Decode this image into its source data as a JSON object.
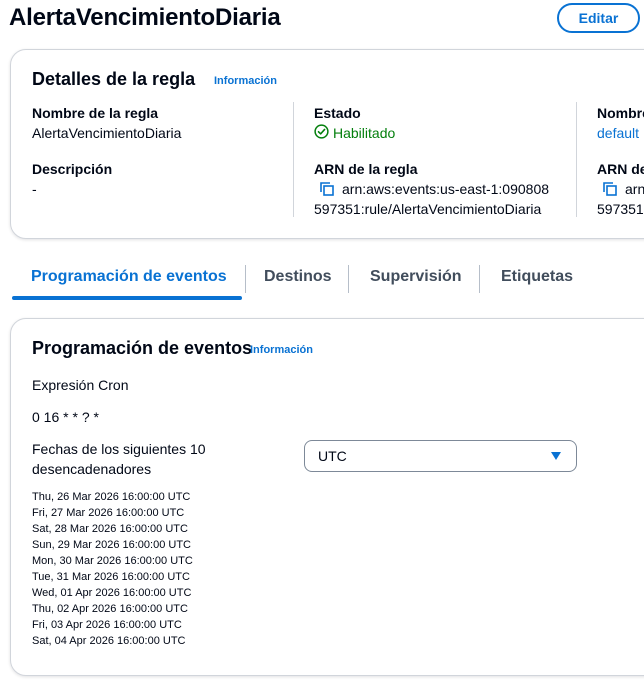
{
  "header": {
    "title": "AlertaVencimientoDiaria",
    "edit_label": "Editar"
  },
  "details": {
    "title": "Detalles de la regla",
    "info_label": "Información",
    "rule_name_label": "Nombre de la regla",
    "rule_name_value": "AlertaVencimientoDiaria",
    "description_label": "Descripción",
    "description_value": "-",
    "status_label": "Estado",
    "status_value": "Habilitado",
    "arn_label": "ARN de la regla",
    "arn_line1": "arn:aws:events:us-east-1:090808",
    "arn_line2": "597351:rule/AlertaVencimientoDiaria",
    "col3_label1": "Nombre",
    "col3_value1": "default",
    "col3_label2": "ARN de",
    "col3_arn_line1": "arn",
    "col3_arn_line2": "597351"
  },
  "tabs": [
    {
      "label": "Programación de eventos"
    },
    {
      "label": "Destinos"
    },
    {
      "label": "Supervisión"
    },
    {
      "label": "Etiquetas"
    }
  ],
  "schedule": {
    "title": "Programación de eventos",
    "info_label": "Información",
    "cron_label": "Expresión Cron",
    "cron_value": "0 16 * * ? *",
    "next_label_line1": "Fechas de los siguientes 10",
    "next_label_line2": "desencadenadores",
    "timezone_selected": "UTC",
    "next_triggers": [
      "Thu, 26 Mar 2026 16:00:00 UTC",
      "Fri, 27 Mar 2026 16:00:00 UTC",
      "Sat, 28 Mar 2026 16:00:00 UTC",
      "Sun, 29 Mar 2026 16:00:00 UTC",
      "Mon, 30 Mar 2026 16:00:00 UTC",
      "Tue, 31 Mar 2026 16:00:00 UTC",
      "Wed, 01 Apr 2026 16:00:00 UTC",
      "Thu, 02 Apr 2026 16:00:00 UTC",
      "Fri, 03 Apr 2026 16:00:00 UTC",
      "Sat, 04 Apr 2026 16:00:00 UTC"
    ]
  },
  "colors": {
    "accent": "#0972d3",
    "success": "#037f0c",
    "text": "#000716"
  },
  "icons": {
    "status": "status-check-icon",
    "copy": "copy-icon",
    "dropdown": "caret-down-icon"
  }
}
